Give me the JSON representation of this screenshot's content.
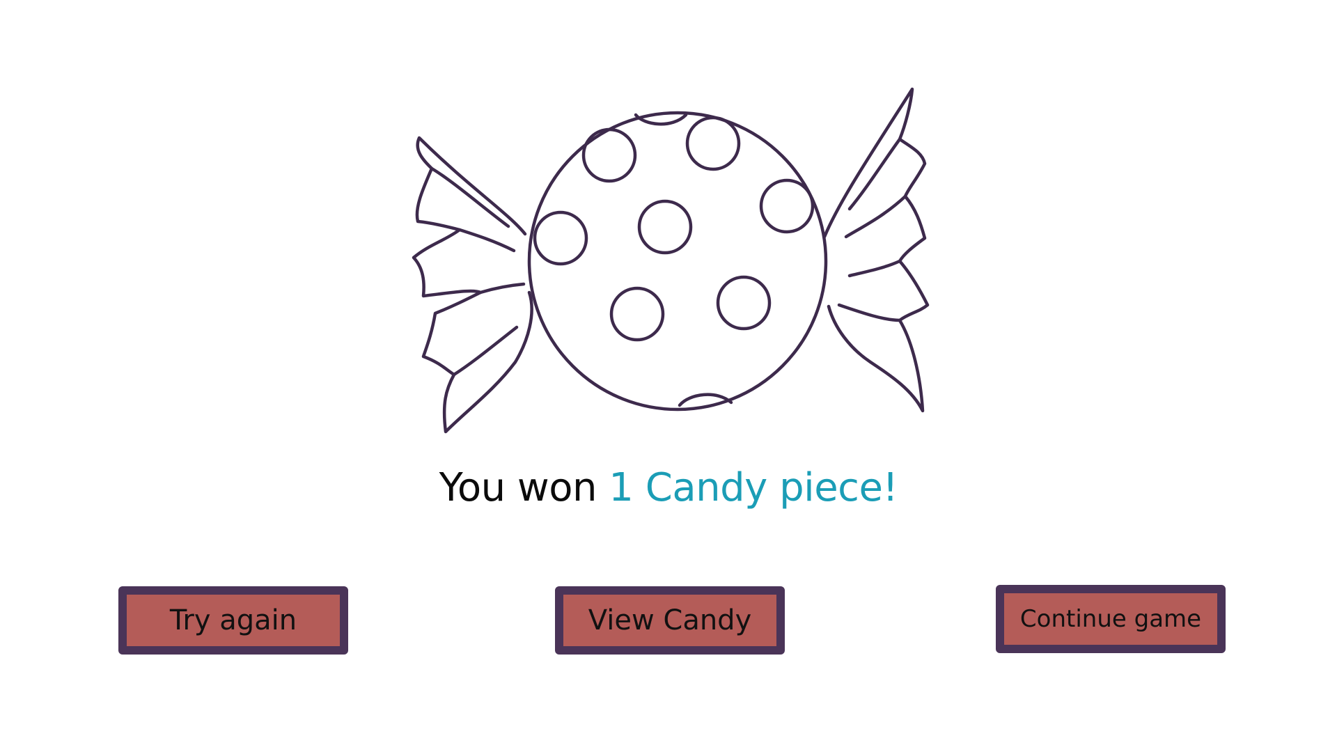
{
  "result": {
    "prefix": "You won ",
    "prize": "1 Candy piece!"
  },
  "buttons": {
    "try_again": "Try again",
    "view_candy": "View Candy",
    "continue_game": "Continue game"
  },
  "colors": {
    "outline": "#3d2a4c",
    "prize_text": "#1b9db6",
    "button_fill": "#b45c58",
    "button_border": "#4a3458"
  },
  "icons": {
    "candy": "wrapped-candy-icon"
  }
}
